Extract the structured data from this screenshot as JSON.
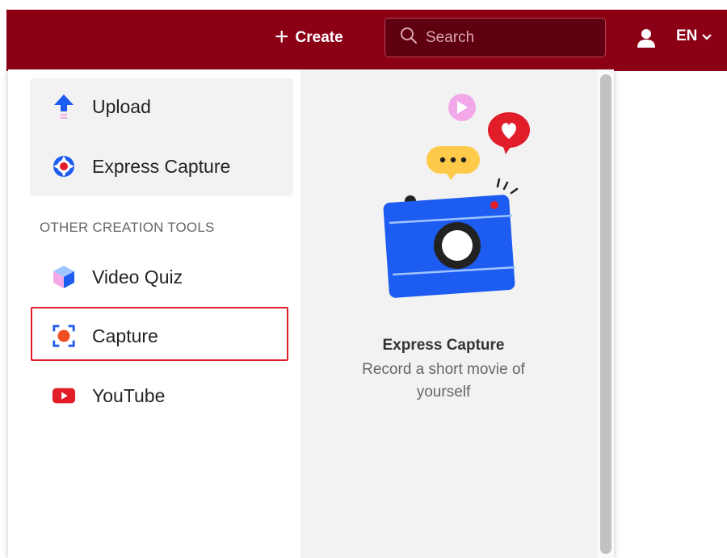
{
  "header": {
    "create_label": "Create",
    "search_placeholder": "Search",
    "language": "EN",
    "background_color": "#8c0016"
  },
  "menu": {
    "primary_items": [
      {
        "label": "Upload",
        "icon": "upload-arrow-icon"
      },
      {
        "label": "Express Capture",
        "icon": "express-capture-icon"
      }
    ],
    "section_label": "OTHER CREATION TOOLS",
    "other_items": [
      {
        "label": "Video Quiz",
        "icon": "cube-icon"
      },
      {
        "label": "Capture",
        "icon": "record-icon",
        "highlighted": true
      },
      {
        "label": "YouTube",
        "icon": "youtube-icon"
      }
    ]
  },
  "preview": {
    "title": "Express Capture",
    "description": "Record a short movie of yourself",
    "illustration": "camera-with-reactions-illustration"
  },
  "colors": {
    "highlight_border": "#e11d2a",
    "camera_blue": "#1d5cf0"
  }
}
